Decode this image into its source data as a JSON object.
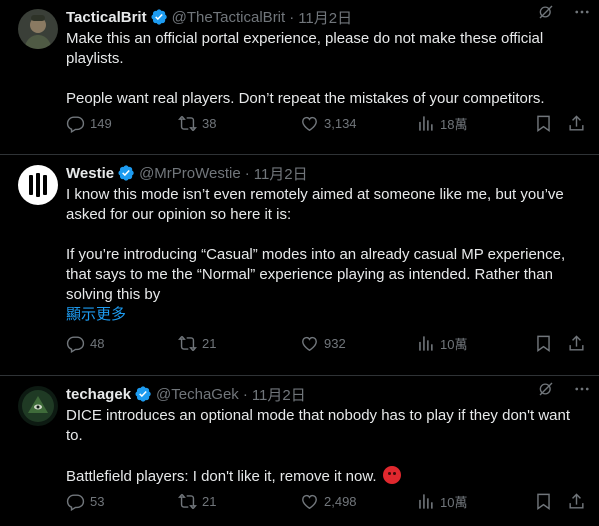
{
  "tweets": [
    {
      "name": "TacticalBrit",
      "handle": "@TheTacticalBrit",
      "date": "11月2日",
      "lines": [
        "Make this an official portal experience, please do not make these official playlists.",
        "",
        "People want real players. Don’t repeat the mistakes of your competitors."
      ],
      "show_more": "",
      "replies": "149",
      "reposts": "38",
      "likes": "3,134",
      "views": "18萬"
    },
    {
      "name": "Westie",
      "handle": "@MrProWestie",
      "date": "11月2日",
      "lines": [
        "I know this mode isn’t even remotely aimed at someone like me, but you’ve asked for our opinion so here it is:",
        "",
        "If you’re introducing “Casual” modes into an already casual MP experience, that says to me the “Normal” experience playing as intended. Rather than solving this by"
      ],
      "show_more": "顯示更多",
      "replies": "48",
      "reposts": "21",
      "likes": "932",
      "views": "10萬"
    },
    {
      "name": "techagek",
      "handle": "@TechaGek",
      "date": "11月2日",
      "lines": [
        "DICE introduces an optional mode that nobody has to play if they don't want to.",
        "",
        "Battlefield players: I don't like it, remove it now."
      ],
      "show_more": "",
      "replies": "53",
      "reposts": "21",
      "likes": "2,498",
      "views": "10萬"
    }
  ],
  "icons": [
    "grok-icon",
    "more-icon",
    "reply-icon",
    "repost-icon",
    "like-icon",
    "views-icon",
    "bookmark-icon",
    "share-icon",
    "verified-icon",
    "angry-emoji-icon"
  ],
  "colors": {
    "background": "#000000",
    "text": "#e7e9ea",
    "muted": "#71767b",
    "accent": "#1d9bf0",
    "divider": "#2f3336"
  }
}
